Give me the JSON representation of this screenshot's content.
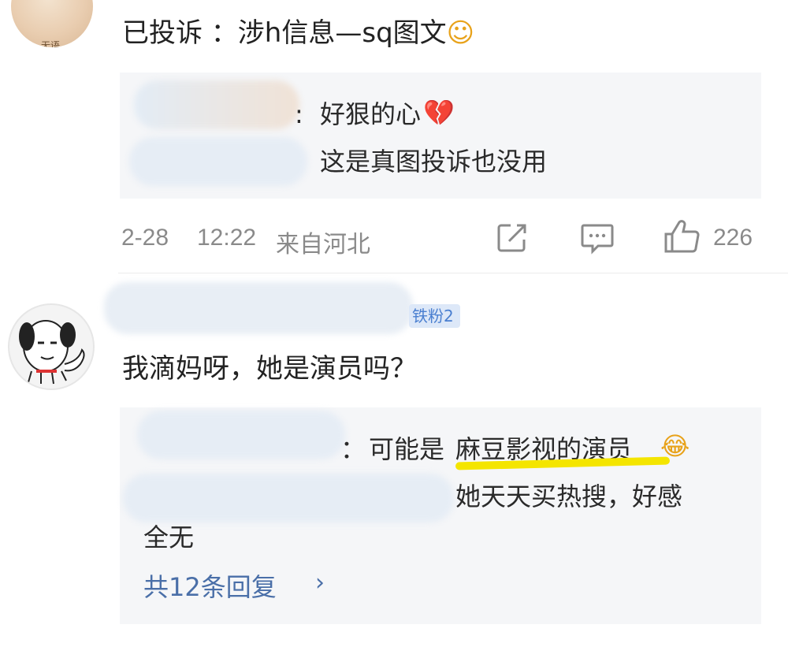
{
  "comment1": {
    "avatar_tag": "无语",
    "text": "已投诉 ：涉h信息—sq图文",
    "emoji": "☺",
    "replies": [
      {
        "sep": ":",
        "text": "好狠的心",
        "emoji": "💔"
      },
      {
        "text": "这是真图投诉也没用"
      }
    ],
    "meta": {
      "date": "2-28",
      "time": "12:22",
      "location": "来自河北",
      "like_count": "226"
    }
  },
  "comment2": {
    "badge": "铁粉2",
    "text": "我滴妈呀，她是演员吗？",
    "replies": [
      {
        "sep": "：",
        "text_before": "可能是",
        "text_highlight": "麻豆影视的演员",
        "emoji": "😂"
      },
      {
        "text_line1": "她天天买热搜，好感",
        "text_line2": "全无"
      }
    ],
    "more_replies": "共12条回复",
    "more_arrow": "›"
  },
  "colors": {
    "highlight": "#f4e500",
    "link": "#4a6fa8",
    "reply_bg": "#f5f6f8"
  }
}
